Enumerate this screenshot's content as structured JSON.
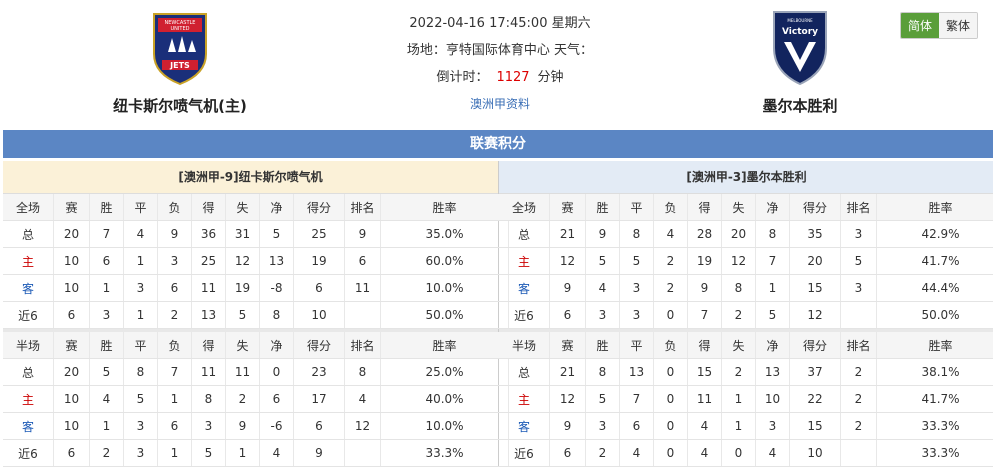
{
  "lang": {
    "simplified": "简体",
    "traditional": "繁体"
  },
  "home_team": {
    "name": "纽卡斯尔喷气机(主)",
    "logo_text": [
      "NEWCASTLE",
      "UNITED",
      "JETS"
    ]
  },
  "away_team": {
    "name": "墨尔本胜利",
    "logo_text": [
      "MELBOURNE",
      "Victory"
    ]
  },
  "match": {
    "datetime": "2022-04-16 17:45:00 星期六",
    "venue": "场地：亨特国际体育中心 天气：",
    "countdown_label": "倒计时：",
    "countdown_value": "1127",
    "countdown_unit": "分钟",
    "league_link": "澳洲甲资料"
  },
  "banner": "联赛积分",
  "headers_full": [
    "全场",
    "赛",
    "胜",
    "平",
    "负",
    "得",
    "失",
    "净",
    "得分",
    "排名",
    "胜率"
  ],
  "headers_half": [
    "半场",
    "赛",
    "胜",
    "平",
    "负",
    "得",
    "失",
    "净",
    "得分",
    "排名",
    "胜率"
  ],
  "left": {
    "title": "[澳洲甲-9]纽卡斯尔喷气机",
    "full": [
      [
        "总",
        "20",
        "7",
        "4",
        "9",
        "36",
        "31",
        "5",
        "25",
        "9",
        "35.0%"
      ],
      [
        "主",
        "10",
        "6",
        "1",
        "3",
        "25",
        "12",
        "13",
        "19",
        "6",
        "60.0%"
      ],
      [
        "客",
        "10",
        "1",
        "3",
        "6",
        "11",
        "19",
        "-8",
        "6",
        "11",
        "10.0%"
      ],
      [
        "近6",
        "6",
        "3",
        "1",
        "2",
        "13",
        "5",
        "8",
        "10",
        "",
        "50.0%"
      ]
    ],
    "half": [
      [
        "总",
        "20",
        "5",
        "8",
        "7",
        "11",
        "11",
        "0",
        "23",
        "8",
        "25.0%"
      ],
      [
        "主",
        "10",
        "4",
        "5",
        "1",
        "8",
        "2",
        "6",
        "17",
        "4",
        "40.0%"
      ],
      [
        "客",
        "10",
        "1",
        "3",
        "6",
        "3",
        "9",
        "-6",
        "6",
        "12",
        "10.0%"
      ],
      [
        "近6",
        "6",
        "2",
        "3",
        "1",
        "5",
        "1",
        "4",
        "9",
        "",
        "33.3%"
      ]
    ]
  },
  "right": {
    "title": "[澳洲甲-3]墨尔本胜利",
    "full": [
      [
        "总",
        "21",
        "9",
        "8",
        "4",
        "28",
        "20",
        "8",
        "35",
        "3",
        "42.9%"
      ],
      [
        "主",
        "12",
        "5",
        "5",
        "2",
        "19",
        "12",
        "7",
        "20",
        "5",
        "41.7%"
      ],
      [
        "客",
        "9",
        "4",
        "3",
        "2",
        "9",
        "8",
        "1",
        "15",
        "3",
        "44.4%"
      ],
      [
        "近6",
        "6",
        "3",
        "3",
        "0",
        "7",
        "2",
        "5",
        "12",
        "",
        "50.0%"
      ]
    ],
    "half": [
      [
        "总",
        "21",
        "8",
        "13",
        "0",
        "15",
        "2",
        "13",
        "37",
        "2",
        "38.1%"
      ],
      [
        "主",
        "12",
        "5",
        "7",
        "0",
        "11",
        "1",
        "10",
        "22",
        "2",
        "41.7%"
      ],
      [
        "客",
        "9",
        "3",
        "6",
        "0",
        "4",
        "1",
        "3",
        "15",
        "2",
        "33.3%"
      ],
      [
        "近6",
        "6",
        "2",
        "4",
        "0",
        "4",
        "0",
        "4",
        "10",
        "",
        "33.3%"
      ]
    ]
  }
}
